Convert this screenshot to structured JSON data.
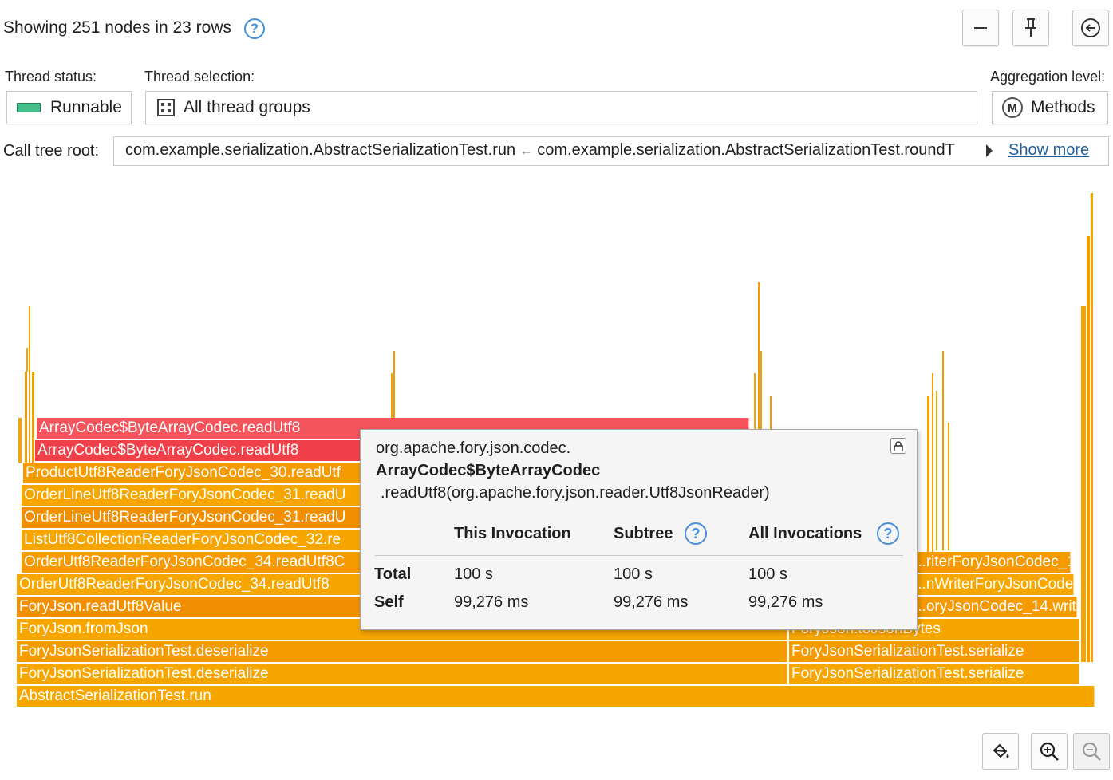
{
  "header": {
    "status_text": "Showing 251 nodes in 23 rows",
    "help_icon": "help-icon",
    "buttons": [
      "minus-icon",
      "pin-icon",
      "back-arrow-icon"
    ]
  },
  "filters": {
    "thread_status_label": "Thread status:",
    "thread_status_value": "Runnable",
    "thread_status_color": "#43c08a",
    "thread_selection_label": "Thread selection:",
    "thread_selection_value": "All thread groups",
    "aggregation_label": "Aggregation level:",
    "aggregation_value": "Methods",
    "aggregation_icon_letter": "M"
  },
  "call_tree_root": {
    "label": "Call tree root:",
    "first": "com.example.serialization.AbstractSerializationTest.run",
    "separator": "←",
    "second": "com.example.serialization.AbstractSerializationTest.roundT",
    "show_more": "Show more"
  },
  "flame": {
    "rows": {
      "r0": "AbstractSerializationTest.run",
      "r1a": "ForyJsonSerializationTest.deserialize",
      "r1b": "ForyJsonSerializationTest.serialize",
      "r2a": "ForyJsonSerializationTest.deserialize",
      "r2b": "ForyJsonSerializationTest.serialize",
      "r3a": "ForyJson.fromJson",
      "r3b": "ForyJson.toJsonBytes",
      "r4a": "ForyJson.readUtf8Value",
      "r4b": "...oryJsonCodec_14.writ",
      "r5a": "OrderUtf8ReaderForyJsonCodec_34.readUtf8",
      "r5b": "...nWriterForyJsonCode",
      "r6a": "OrderUtf8ReaderForyJsonCodec_34.readUtf8C",
      "r6b": "...riterForyJsonCodec_1",
      "r7": "ListUtf8CollectionReaderForyJsonCodec_32.re",
      "r8": "OrderLineUtf8ReaderForyJsonCodec_31.readU",
      "r9": "OrderLineUtf8ReaderForyJsonCodec_31.readU",
      "r10": "ProductUtf8ReaderForyJsonCodec_30.readUtf",
      "r11": "ArrayCodec$ByteArrayCodec.readUtf8",
      "r12": "ArrayCodec$ByteArrayCodec.readUtf8"
    },
    "hot_color": "#ef404a",
    "base_color": "#f7a600"
  },
  "tooltip": {
    "package": "org.apache.fory.json.codec.",
    "class": "ArrayCodec$ByteArrayCodec",
    "method": ".readUtf8(org.apache.fory.json.reader.Utf8JsonReader)",
    "col_this": "This Invocation",
    "col_subtree": "Subtree",
    "col_all": "All Invocations",
    "row_total": "Total",
    "row_self": "Self",
    "total_this": "100 s",
    "total_subtree": "100 s",
    "total_all": "100 s",
    "self_this": "99,276 ms",
    "self_subtree": "99,276 ms",
    "self_all": "99,276 ms"
  },
  "bottom_toolbar": [
    "paint-bucket-icon",
    "zoom-in-icon",
    "zoom-out-icon"
  ]
}
